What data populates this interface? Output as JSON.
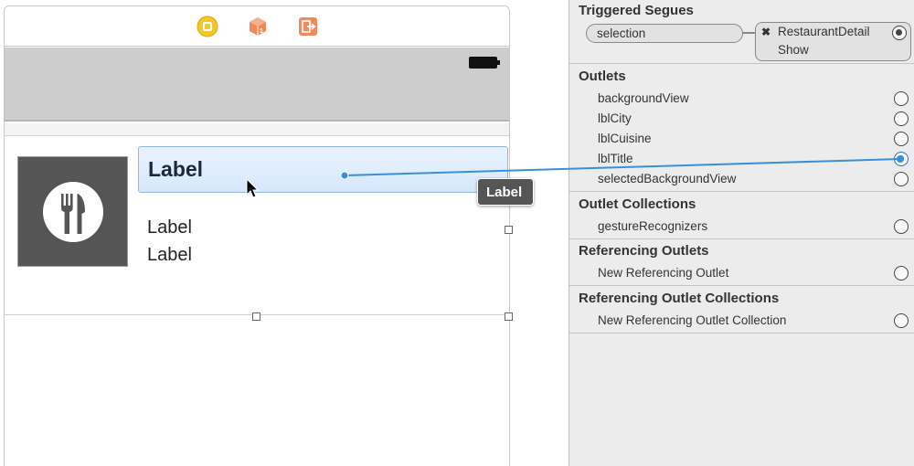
{
  "canvas": {
    "dock_icons": [
      "view-controller-icon",
      "first-responder-icon",
      "exit-icon"
    ],
    "cell": {
      "title_label": "Label",
      "label_2": "Label",
      "label_3": "Label",
      "thumbnail_icon": "fork-knife-icon"
    },
    "drag_tooltip": "Label"
  },
  "inspector": {
    "triggered_segues": {
      "title": "Triggered Segues",
      "trigger": "selection",
      "destination": "RestaurantDetail",
      "kind": "Show",
      "remove_glyph": "✖"
    },
    "outlets": {
      "title": "Outlets",
      "items": [
        "backgroundView",
        "lblCity",
        "lblCuisine",
        "lblTitle",
        "selectedBackgroundView"
      ]
    },
    "outlet_collections": {
      "title": "Outlet Collections",
      "items": [
        "gestureRecognizers"
      ]
    },
    "referencing_outlets": {
      "title": "Referencing Outlets",
      "items": [
        "New Referencing Outlet"
      ]
    },
    "referencing_outlet_collections": {
      "title": "Referencing Outlet Collections",
      "items": [
        "New Referencing Outlet Collection"
      ]
    }
  },
  "colors": {
    "connection": "#3a8fd9",
    "navbar": "#cdcdcd",
    "inspector_bg": "#ececec"
  }
}
